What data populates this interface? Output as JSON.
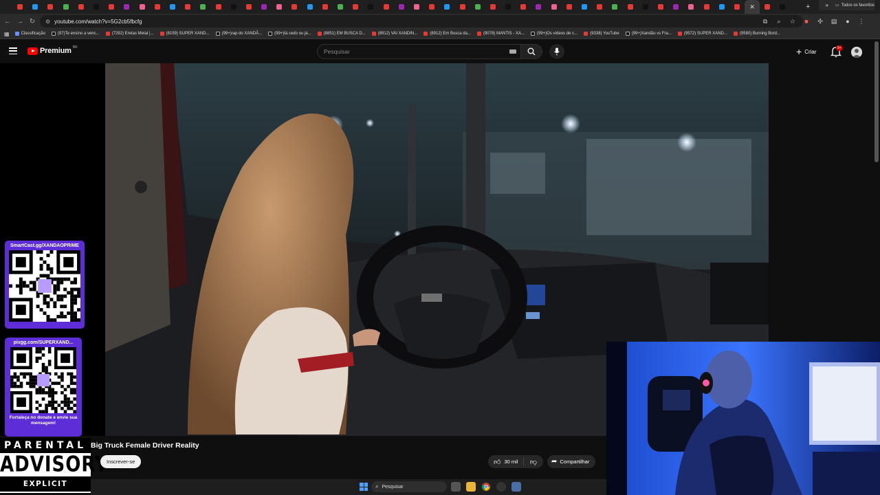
{
  "browser": {
    "tab_count": 51,
    "url": "youtube.com/watch?v=5G2cb5fbcfg",
    "bookmarks": [
      {
        "label": "Classificação",
        "kind": "gr"
      },
      {
        "label": "(97)Te ensino a venc...",
        "kind": "tk"
      },
      {
        "label": "(7292) Eretas Metal |...",
        "kind": "yt"
      },
      {
        "label": "(8159) SUPER XAND...",
        "kind": "yt"
      },
      {
        "label": "(99+)rap do XANDÃ...",
        "kind": "tk"
      },
      {
        "label": "(99+)tá cedo ou já...",
        "kind": "tk"
      },
      {
        "label": "(8851) EM BUSCA D...",
        "kind": "yt"
      },
      {
        "label": "(8912) VAI XANDIN...",
        "kind": "yt"
      },
      {
        "label": "(8912) Em Busca da...",
        "kind": "yt"
      },
      {
        "label": "(9078) MANTIS - XA...",
        "kind": "yt"
      },
      {
        "label": "(99+)Os vídeos de c...",
        "kind": "tk"
      },
      {
        "label": "(9338) YouTube",
        "kind": "yt"
      },
      {
        "label": "(99+)Xandão vs Fra...",
        "kind": "tk"
      },
      {
        "label": "(9572) SUPER XAND...",
        "kind": "yt"
      },
      {
        "label": "(9580) Burning Bord...",
        "kind": "yt"
      }
    ],
    "all_bookmarks_label": "Todos os favoritos"
  },
  "youtube": {
    "logo_text": "Premium",
    "country_code": "BR",
    "search_placeholder": "Pesquisar",
    "create_label": "Criar",
    "notification_badge": "9+",
    "video_title": "Big Truck Female Driver Reality",
    "subscribe_label": "Inscrever-se",
    "like_count": "30 mil",
    "share_label": "Compartilhar"
  },
  "overlays": {
    "qr1_title": "SmartCast.gg/XANDAOPRIME",
    "qr2_title": "pixgg.com/SUPERXAND...",
    "qr2_footer": "Fortaleça no donate e envie sua mensagem!",
    "advisory_line1": "PARENTAL",
    "advisory_line2": "ADVISORY",
    "advisory_line3": "EXPLICIT CONTENT"
  },
  "taskbar": {
    "search_placeholder": "Pesquisar"
  },
  "colors": {
    "yt_red": "#ff0000",
    "qr_card": "#5d2ed8",
    "bg": "#0f0f0f"
  }
}
